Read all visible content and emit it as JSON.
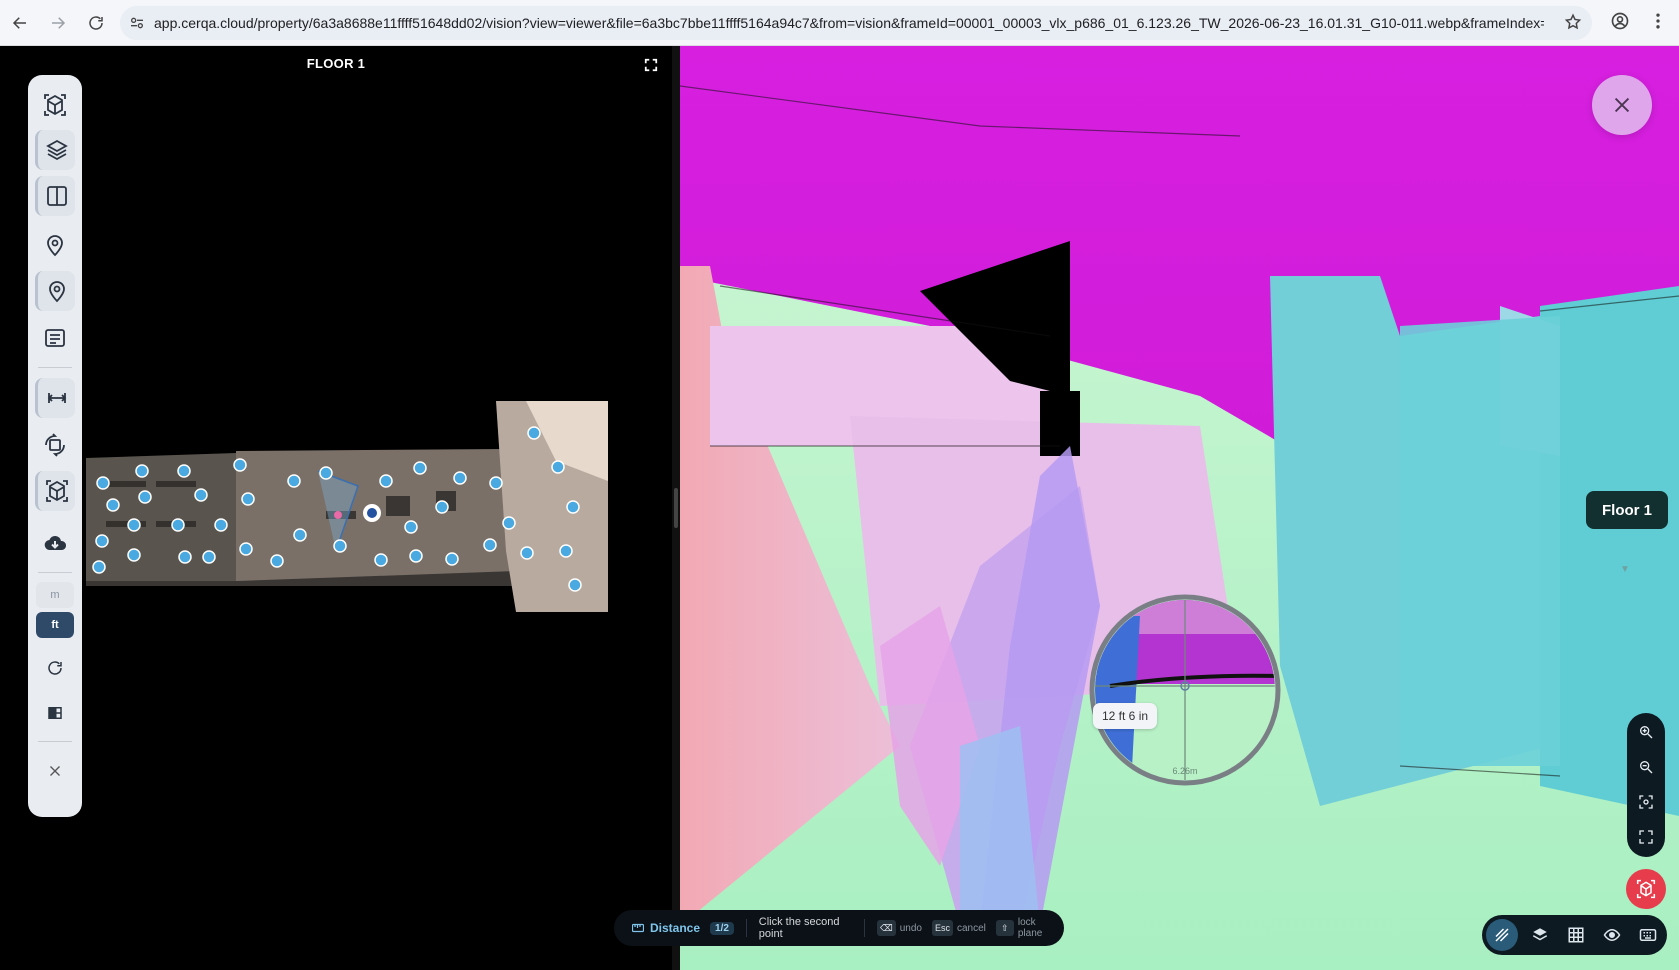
{
  "browser": {
    "url": "app.cerqa.cloud/property/6a3a8688e11ffff51648dd02/vision?view=viewer&file=6a3bc7bbe11ffff5164a94c7&from=vision&frameId=00001_00003_vlx_p686_01_6.123.26_TW_2026-06-23_16.01.31_G10-011.webp&frameIndex=1"
  },
  "left_panel": {
    "floor_title": "FLOOR 1",
    "units": {
      "m": "m",
      "ft": "ft"
    },
    "active_unit": "ft"
  },
  "viewer": {
    "floor_badge": "Floor 1",
    "measurement_label": "12 ft 6 in",
    "loupe_scale": "6.26m"
  },
  "hint_bar": {
    "mode": "Distance",
    "step": "1/2",
    "message": "Click the second point",
    "keys": [
      {
        "key": "⌫",
        "label": "undo"
      },
      {
        "key": "Esc",
        "label": "cancel"
      },
      {
        "key": "⇧",
        "label": "lock plane"
      }
    ]
  },
  "colors": {
    "accent": "#2f4a68",
    "capture": "#e63c4c",
    "ceiling": "#d020d8",
    "wall_cyan": "#62cfd6",
    "floor_green": "#b6f2c6"
  }
}
